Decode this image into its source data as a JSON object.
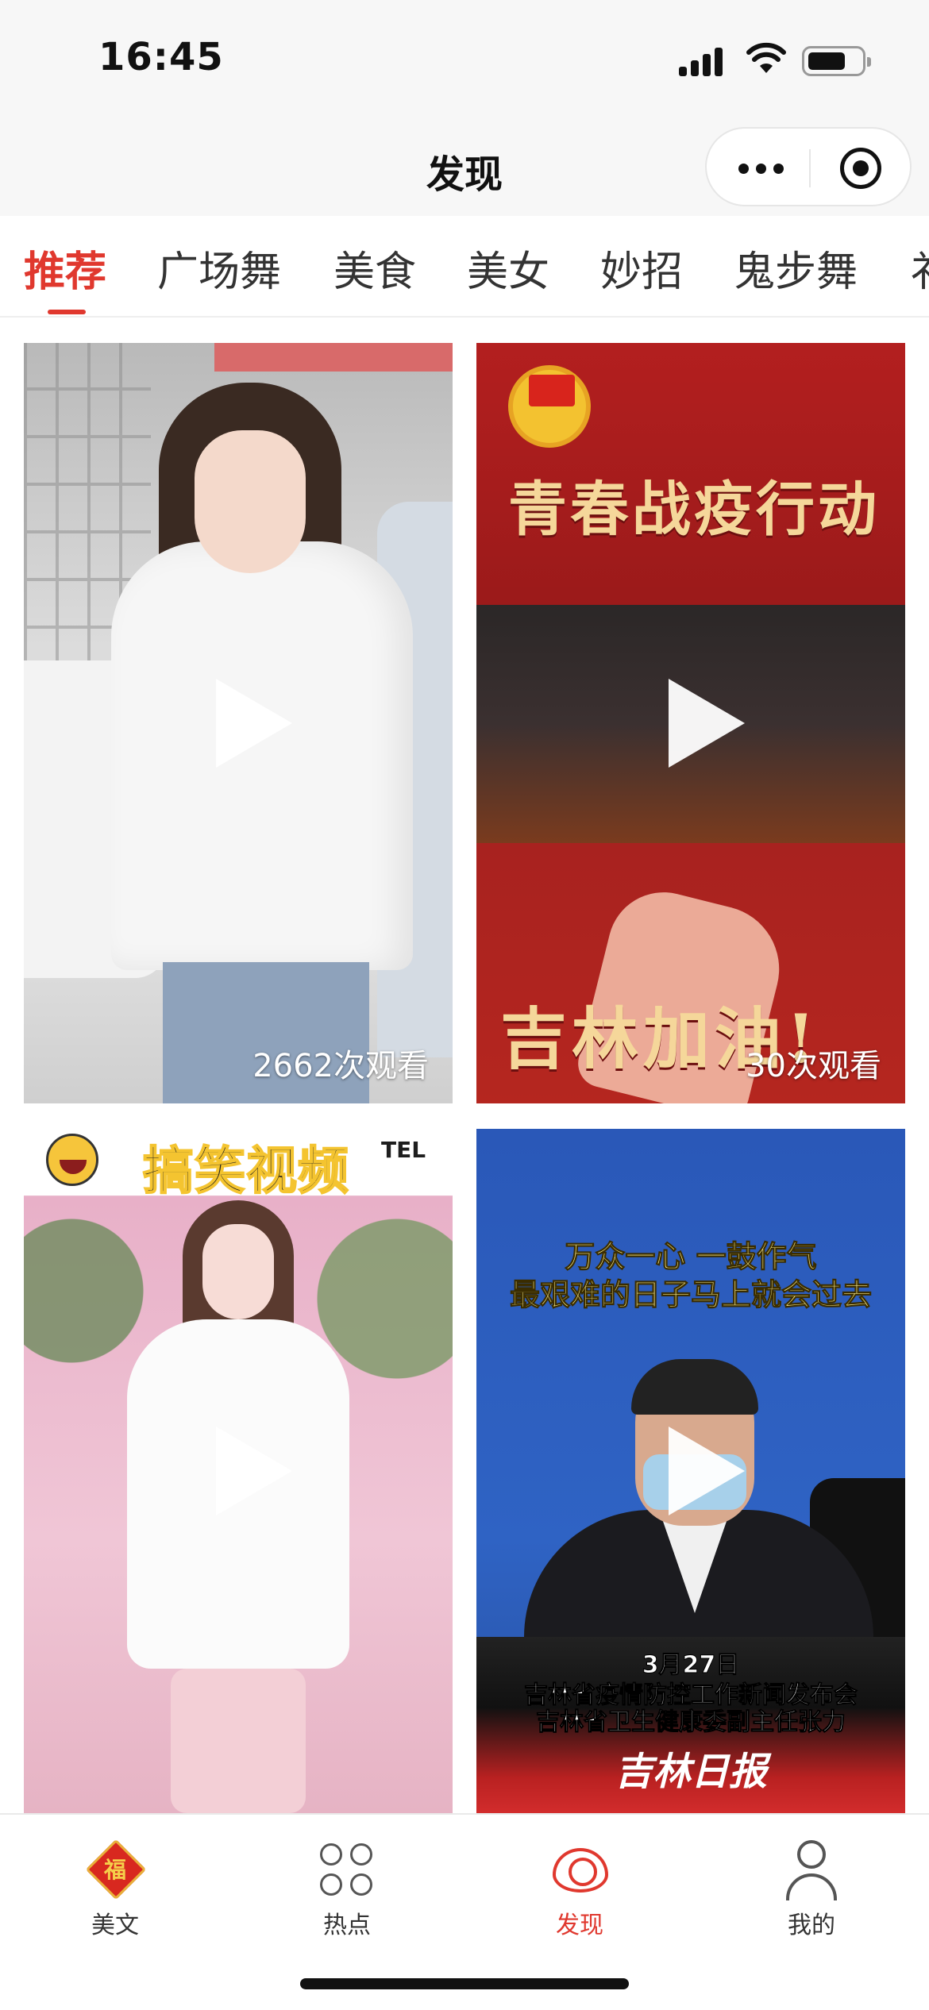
{
  "status_bar": {
    "time": "16:45"
  },
  "header": {
    "title": "发现"
  },
  "tabs": [
    {
      "label": "推荐",
      "active": true
    },
    {
      "label": "广场舞",
      "active": false
    },
    {
      "label": "美食",
      "active": false
    },
    {
      "label": "美女",
      "active": false
    },
    {
      "label": "妙招",
      "active": false
    },
    {
      "label": "鬼步舞",
      "active": false
    },
    {
      "label": "礻",
      "active": false
    }
  ],
  "videos": [
    {
      "views": "2662次观看"
    },
    {
      "headline": "青春战疫行动",
      "bottom_text": "吉林加油!",
      "views": "30次观看"
    },
    {
      "title": "搞笑视频",
      "title_suffix": "TEL"
    },
    {
      "caption_line1": "万众一心 一鼓作气",
      "caption_line2": "最艰难的日子马上就会过去",
      "date": "3月27日",
      "subtitle_line1": "吉林省疫情防控工作新闻发布会",
      "subtitle_line2": "吉林省卫生健康委副主任张力",
      "logo": "吉林日报"
    }
  ],
  "bottom_nav": [
    {
      "label": "美文",
      "icon": "fu-icon",
      "active": false,
      "icon_char": "福"
    },
    {
      "label": "热点",
      "icon": "grid-icon",
      "active": false
    },
    {
      "label": "发现",
      "icon": "eye-icon",
      "active": true
    },
    {
      "label": "我的",
      "icon": "user-icon",
      "active": false
    }
  ],
  "colors": {
    "accent": "#e0382e",
    "header_bg": "#f7f7f7"
  }
}
